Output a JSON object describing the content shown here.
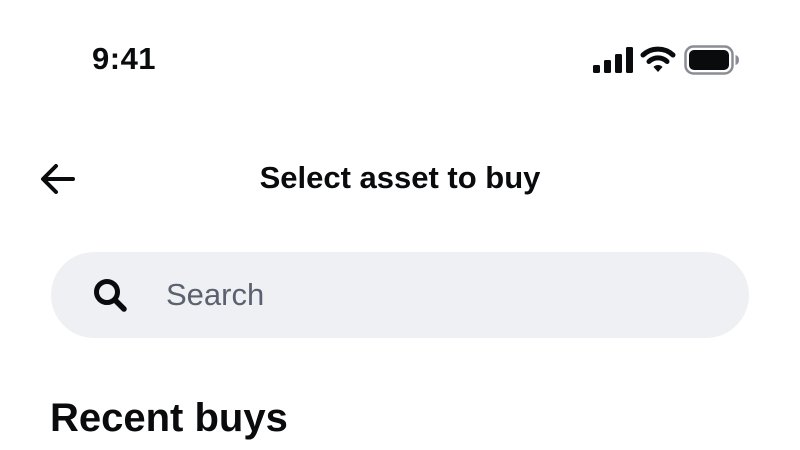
{
  "status_bar": {
    "time": "9:41",
    "icons": [
      "signal-icon",
      "wifi-icon",
      "battery-icon"
    ]
  },
  "header": {
    "back_icon": "arrow-left-icon",
    "title": "Select asset to buy"
  },
  "search": {
    "icon": "search-icon",
    "placeholder": "Search",
    "value": ""
  },
  "sections": {
    "recent_buys": {
      "heading": "Recent buys"
    }
  },
  "colors": {
    "text_primary": "#0a0b0d",
    "search_background": "#eef0f3",
    "placeholder": "#5b616e",
    "page_background": "#ffffff"
  }
}
